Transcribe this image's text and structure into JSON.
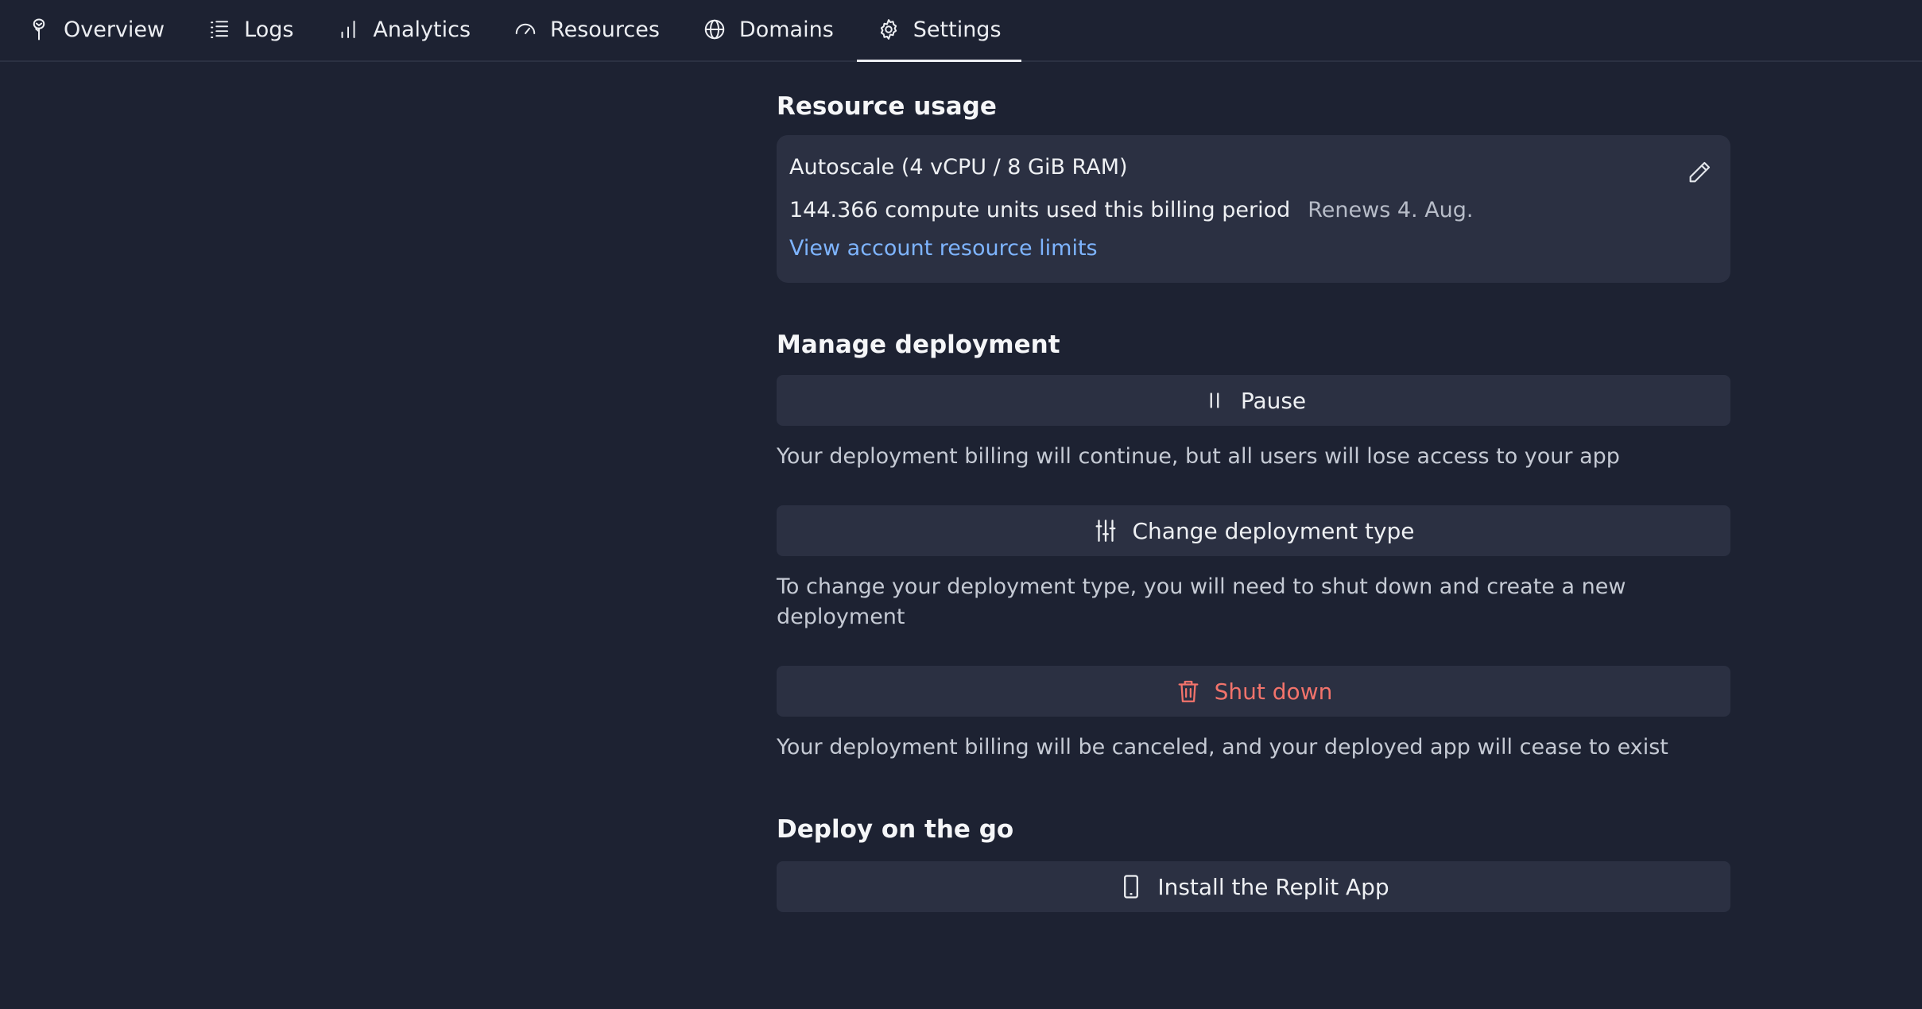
{
  "tabs": [
    {
      "label": "Overview",
      "icon": "tree-icon"
    },
    {
      "label": "Logs",
      "icon": "list-icon"
    },
    {
      "label": "Analytics",
      "icon": "bar-chart-icon"
    },
    {
      "label": "Resources",
      "icon": "gauge-icon"
    },
    {
      "label": "Domains",
      "icon": "globe-icon"
    },
    {
      "label": "Settings",
      "icon": "gear-icon",
      "active": true
    }
  ],
  "resource_usage": {
    "title": "Resource usage",
    "machine": "Autoscale (4 vCPU / 8 GiB RAM)",
    "usage": "144.366 compute units used this billing period",
    "renews": "Renews 4. Aug.",
    "link": "View account resource limits",
    "edit_icon": "pencil-icon"
  },
  "manage": {
    "title": "Manage deployment",
    "pause_label": "Pause",
    "pause_desc": "Your deployment billing will continue, but all users will lose access to your app",
    "change_label": "Change deployment type",
    "change_desc": "To change your deployment type, you will need to shut down and create a new deployment",
    "shutdown_label": "Shut down",
    "shutdown_desc": "Your deployment billing will be canceled, and your deployed app will cease to exist"
  },
  "deploy_go": {
    "title": "Deploy on the go",
    "install_label": "Install the Replit App"
  },
  "colors": {
    "background": "#1d2232",
    "card": "#2b3042",
    "link": "#7eb4ff",
    "danger": "#f2736b"
  }
}
